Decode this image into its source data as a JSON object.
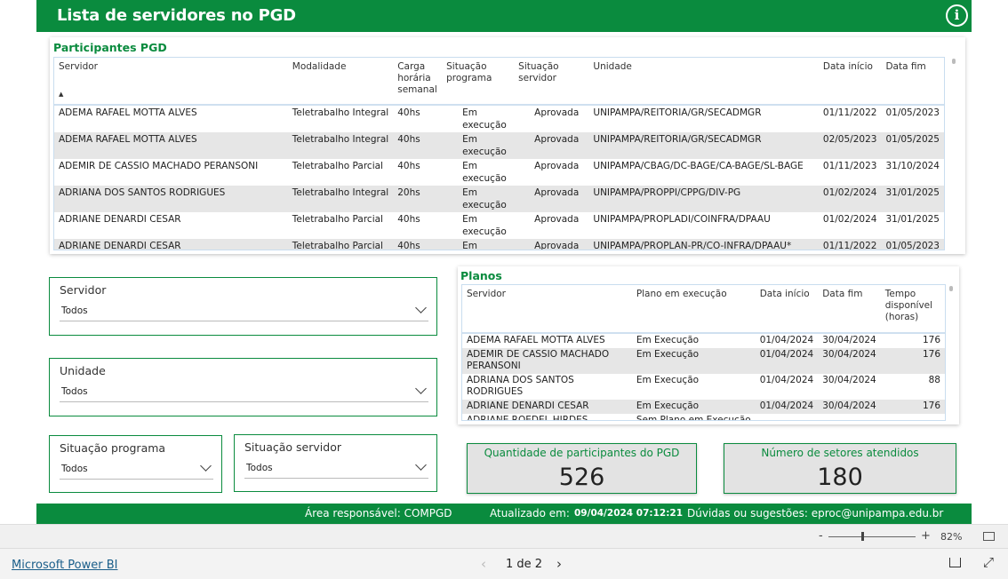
{
  "header": {
    "title": "Lista de servidores no PGD",
    "info_icon": "info-icon"
  },
  "participantes": {
    "title": "Participantes PGD",
    "columns": [
      "Servidor",
      "Modalidade",
      "Carga horária semanal",
      "Situação programa",
      "Situação servidor",
      "Unidade",
      "Data início",
      "Data fim"
    ],
    "rows": [
      [
        "ADEMA RAFAEL MOTTA ALVES",
        "Teletrabalho Integral",
        "40hs",
        "Em execução",
        "Aprovada",
        "UNIPAMPA/REITORIA/GR/SECADMGR",
        "01/11/2022",
        "01/05/2023"
      ],
      [
        "ADEMA RAFAEL MOTTA ALVES",
        "Teletrabalho Integral",
        "40hs",
        "Em execução",
        "Aprovada",
        "UNIPAMPA/REITORIA/GR/SECADMGR",
        "02/05/2023",
        "01/05/2025"
      ],
      [
        "ADEMIR DE CASSIO MACHADO PERANSONI",
        "Teletrabalho Parcial",
        "40hs",
        "Em execução",
        "Aprovada",
        "UNIPAMPA/CBAG/DC-BAGE/CA-BAGE/SL-BAGE",
        "01/11/2023",
        "31/10/2024"
      ],
      [
        "ADRIANA DOS SANTOS RODRIGUES",
        "Teletrabalho Integral",
        "20hs",
        "Em execução",
        "Aprovada",
        "UNIPAMPA/PROPPI/CPPG/DIV-PG",
        "01/02/2024",
        "31/01/2025"
      ],
      [
        "ADRIANE DENARDI CESAR",
        "Teletrabalho Parcial",
        "40hs",
        "Em execução",
        "Aprovada",
        "UNIPAMPA/PROPLADI/COINFRA/DPAAU",
        "01/02/2024",
        "31/01/2025"
      ],
      [
        "ADRIANE DENARDI CESAR",
        "Teletrabalho Parcial",
        "40hs",
        "Em execução",
        "Aprovada",
        "UNIPAMPA/PROPLAN-PR/CO-INFRA/DPAAU*",
        "01/11/2022",
        "01/05/2023"
      ]
    ]
  },
  "planos": {
    "title": "Planos",
    "columns": [
      "Servidor",
      "Plano em execução",
      "Data início",
      "Data fim",
      "Tempo disponível (horas)"
    ],
    "rows": [
      [
        "ADEMA RAFAEL MOTTA ALVES",
        "Em Execução",
        "01/04/2024",
        "30/04/2024",
        "176"
      ],
      [
        "ADEMIR DE CASSIO MACHADO PERANSONI",
        "Em Execução",
        "01/04/2024",
        "30/04/2024",
        "176"
      ],
      [
        "ADRIANA DOS SANTOS RODRIGUES",
        "Em Execução",
        "01/04/2024",
        "30/04/2024",
        "88"
      ],
      [
        "ADRIANE DENARDI CESAR",
        "Em Execução",
        "01/04/2024",
        "30/04/2024",
        "176"
      ],
      [
        "ADRIANE ROEDEL HIRDES",
        "Sem Plano em Execução",
        "",
        "",
        ""
      ]
    ]
  },
  "filters": {
    "servidor": {
      "label": "Servidor",
      "value": "Todos"
    },
    "unidade": {
      "label": "Unidade",
      "value": "Todos"
    },
    "situacao_programa": {
      "label": "Situação programa",
      "value": "Todos"
    },
    "situacao_servidor": {
      "label": "Situação servidor",
      "value": "Todos"
    }
  },
  "kpis": {
    "participantes": {
      "label": "Quantidade de participantes do PGD",
      "value": "526"
    },
    "setores": {
      "label": "Número de setores atendidos",
      "value": "180"
    }
  },
  "footer": {
    "area": "Área responsável: COMPGD",
    "atualizado_label": "Atualizado em:",
    "atualizado_value": "09/04/2024 07:12:21",
    "duvidas": "Dúvidas ou sugestões: eproc@unipampa.edu.br"
  },
  "zoom": {
    "minus": "-",
    "plus": "+",
    "level": "82%"
  },
  "bottom": {
    "link": "Microsoft Power BI",
    "page": "1 de 2"
  },
  "colors": {
    "brand": "#0a8b3e",
    "alt_row": "#e6e6e6"
  }
}
